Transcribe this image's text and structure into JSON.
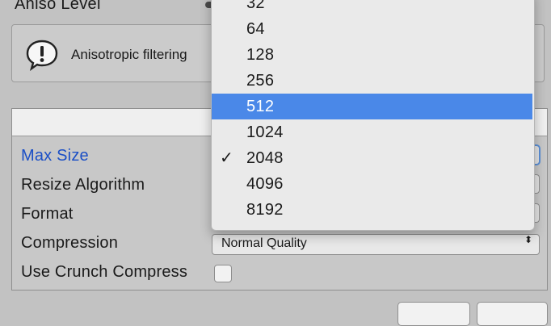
{
  "aniso": {
    "label": "Aniso Level"
  },
  "help": {
    "text": "Anisotropic filtering",
    "trailing": "."
  },
  "rows": {
    "max_size": "Max Size",
    "resize_algorithm": "Resize Algorithm",
    "format": "Format",
    "compression": "Compression",
    "use_crunch": "Use Crunch Compress"
  },
  "compression_popup": {
    "value": "Normal Quality",
    "arrows": "⬍"
  },
  "max_size_menu": {
    "items": [
      "32",
      "64",
      "128",
      "256",
      "512",
      "1024",
      "2048",
      "4096",
      "8192"
    ],
    "highlighted": "512",
    "checked": "2048",
    "check_glyph": "✓"
  },
  "colors": {
    "selection_blue": "#4a88e8",
    "selected_label": "#1b4fc6"
  }
}
